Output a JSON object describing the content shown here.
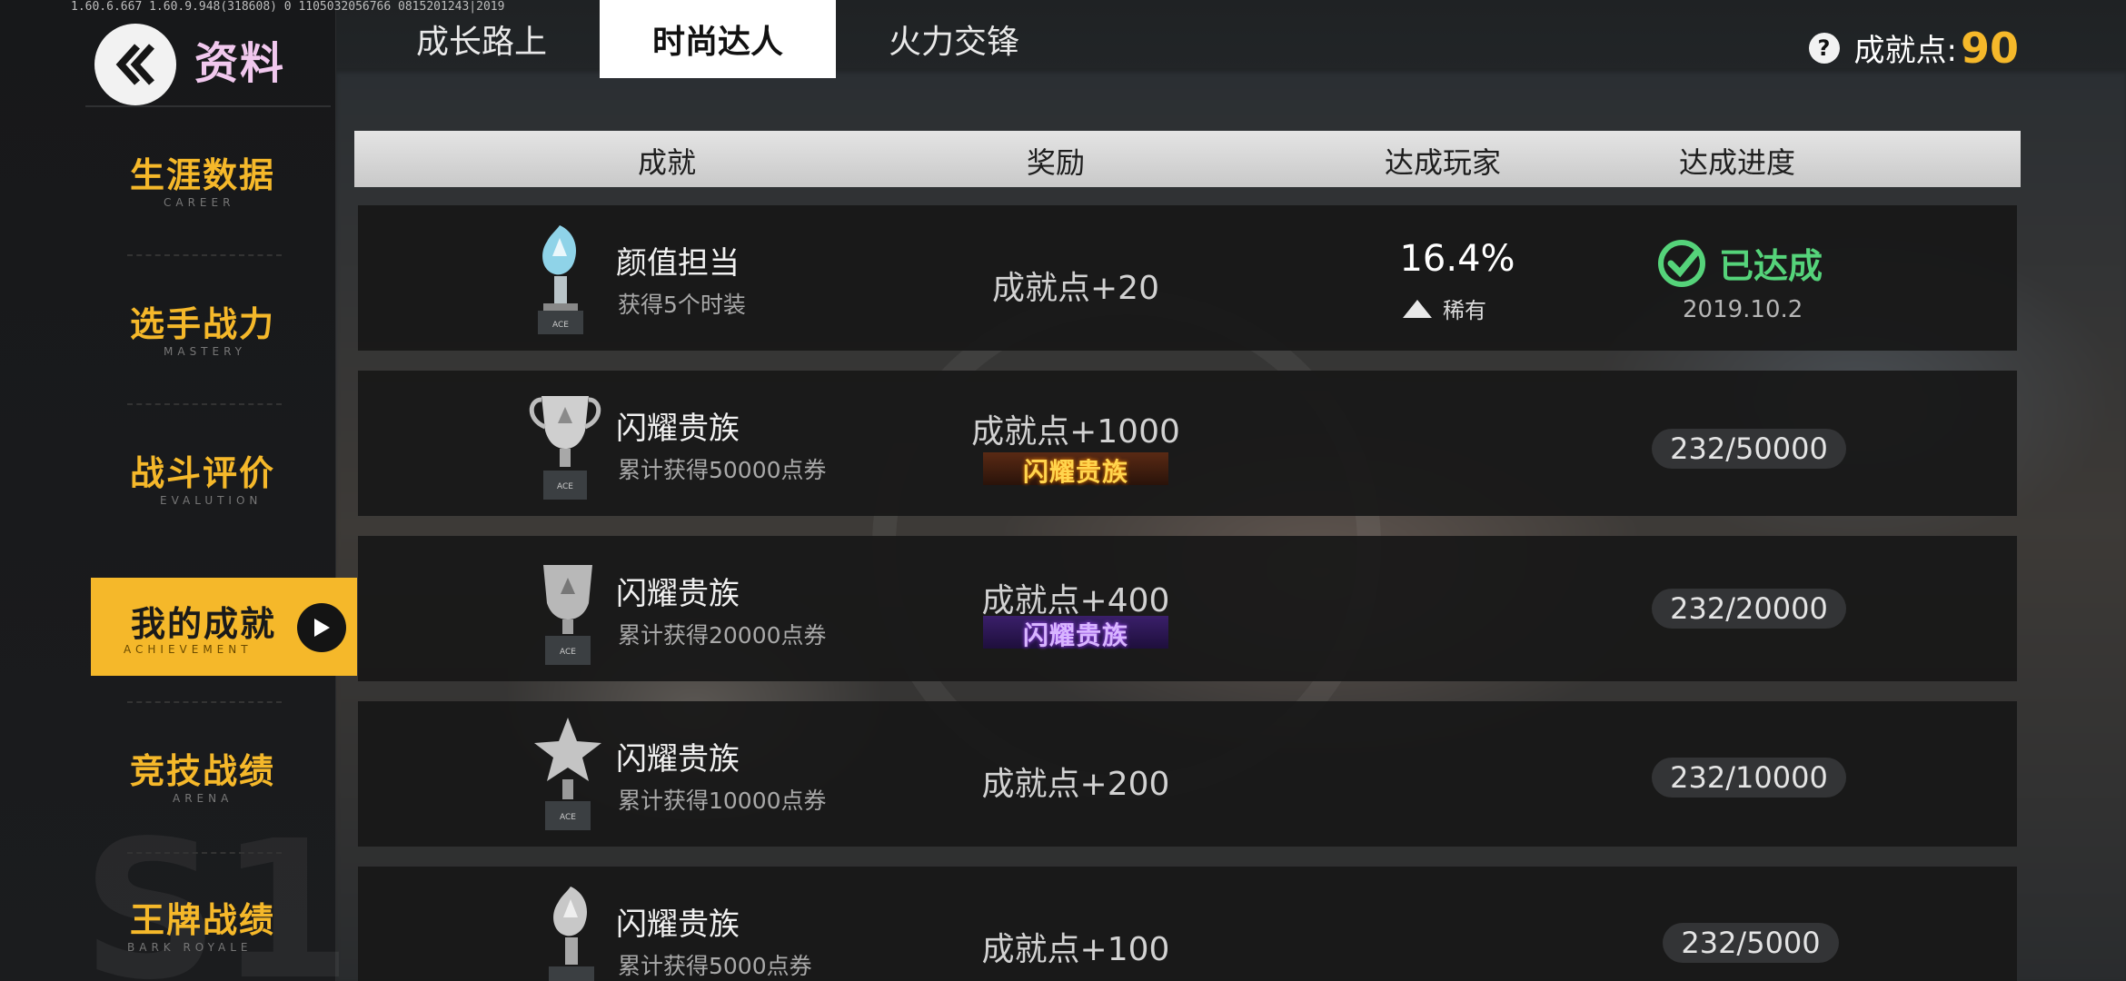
{
  "version_text": "1.60.6.667  1.60.9.948(318608)  0  1105032056766    0815201243|2019",
  "sidebar": {
    "title": "资料",
    "items": [
      {
        "zh": "生涯数据",
        "en": "CAREER"
      },
      {
        "zh": "选手战力",
        "en": "MASTERY"
      },
      {
        "zh": "战斗评价",
        "en": "EVALUTION"
      },
      {
        "zh": "我的成就",
        "en": "ACHIEVEMENT"
      },
      {
        "zh": "竞技战绩",
        "en": "ARENA"
      },
      {
        "zh": "王牌战绩",
        "en": "BARK ROYALE"
      }
    ],
    "active_index": 3
  },
  "tabs": [
    "成长路上",
    "时尚达人",
    "火力交锋"
  ],
  "active_tab": 1,
  "points": {
    "icon": "question-icon",
    "label": "成就点:",
    "value": "90"
  },
  "table": {
    "headers": {
      "achievement": "成就",
      "reward": "奖励",
      "players": "达成玩家",
      "progress": "达成进度"
    },
    "rows": [
      {
        "name": "颜值担当",
        "desc": "获得5个时装",
        "reward": "成就点+20",
        "badge": null,
        "percent": "16.4%",
        "rarity": "稀有",
        "status": "已达成",
        "date": "2019.10.2",
        "progress": null
      },
      {
        "name": "闪耀贵族",
        "desc": "累计获得50000点券",
        "reward": "成就点+1000",
        "badge": "闪耀贵族",
        "badge_color": "#ffd54d",
        "progress": "232/50000"
      },
      {
        "name": "闪耀贵族",
        "desc": "累计获得20000点券",
        "reward": "成就点+400",
        "badge": "闪耀贵族",
        "badge_color": "#d8b5ff",
        "progress": "232/20000"
      },
      {
        "name": "闪耀贵族",
        "desc": "累计获得10000点券",
        "reward": "成就点+200",
        "badge": null,
        "progress": "232/10000"
      },
      {
        "name": "闪耀贵族",
        "desc": "累计获得5000点券",
        "reward": "成就点+100",
        "badge": null,
        "progress": "232/5000"
      }
    ]
  },
  "colors": {
    "accent": "#f5b82a",
    "success": "#55d37a"
  }
}
